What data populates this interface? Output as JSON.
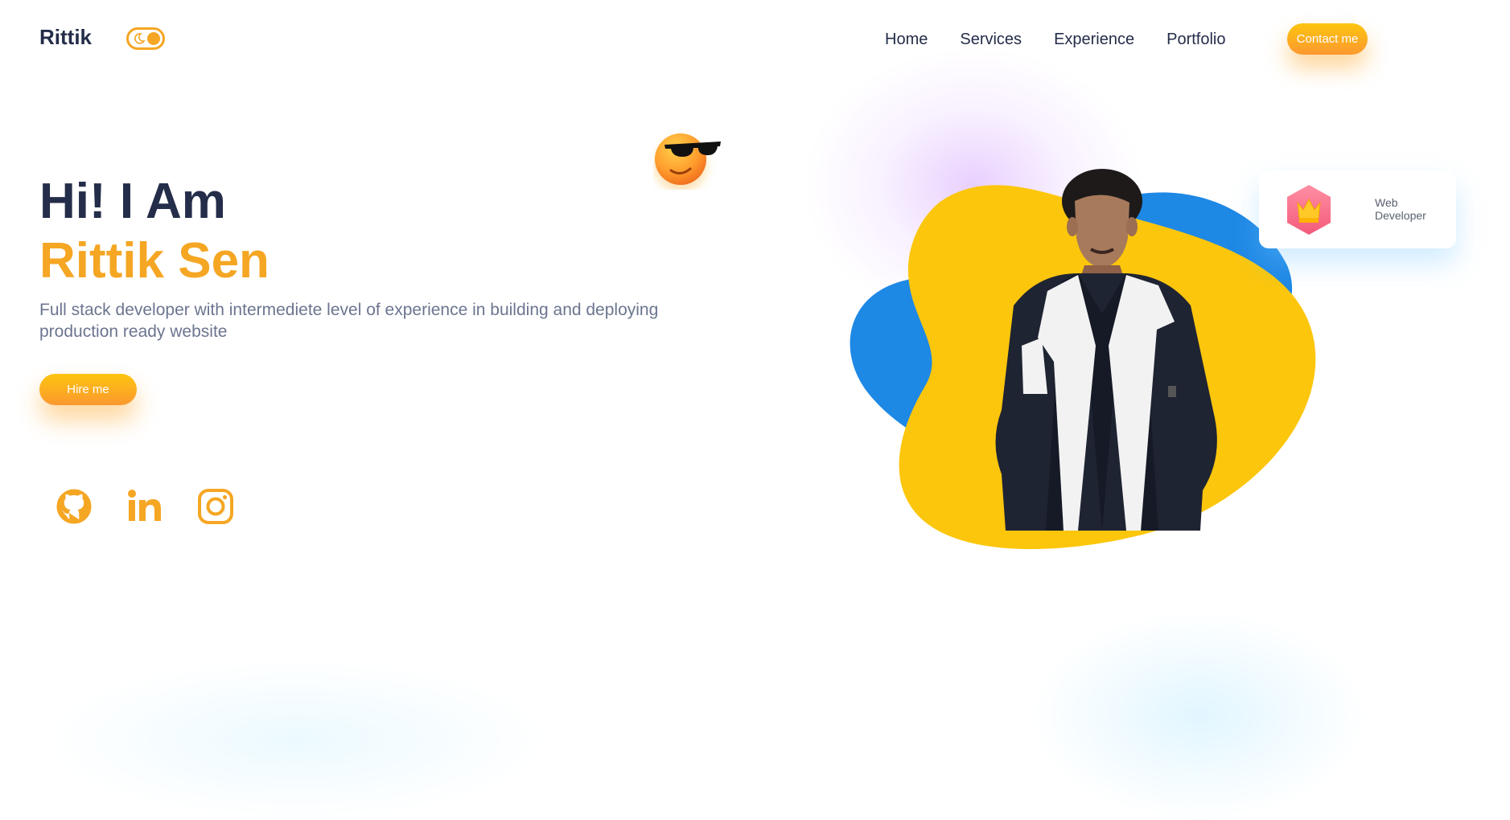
{
  "brand": "Rittik",
  "nav": {
    "items": [
      "Home",
      "Services",
      "Experience",
      "Portfolio"
    ],
    "contact_label": "Contact me"
  },
  "hero": {
    "greeting": "Hi! I Am",
    "name": "Rittik Sen",
    "description": "Full stack developer with intermediete level of experience in building and deploying production ready website",
    "hire_label": "Hire me"
  },
  "socials": [
    "github-icon",
    "linkedin-icon",
    "instagram-icon"
  ],
  "badge": {
    "text": "Web Developer",
    "icon": "crown-icon"
  },
  "colors": {
    "accent": "#f5a623",
    "dark": "#242d49",
    "blob_yellow": "#fcc60c",
    "blob_blue": "#1e88e5",
    "muted": "#6c7590"
  }
}
